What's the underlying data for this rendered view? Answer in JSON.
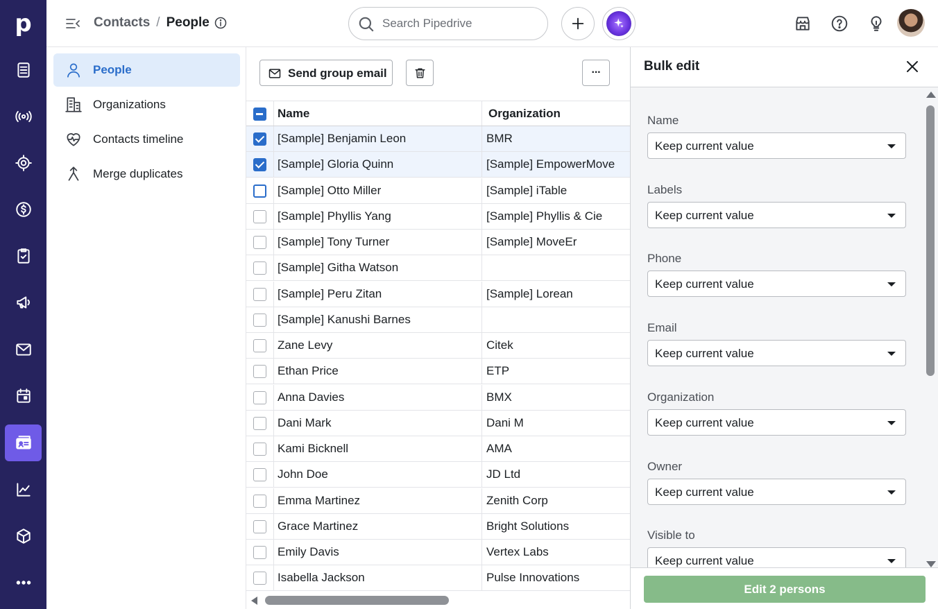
{
  "app": {
    "logo": "p"
  },
  "header": {
    "breadcrumb_parent": "Contacts",
    "breadcrumb_separator": "/",
    "breadcrumb_current": "People",
    "search_placeholder": "Search Pipedrive"
  },
  "rail": {
    "items": [
      {
        "icon": "leads-icon"
      },
      {
        "icon": "campaigns-broadcast-icon"
      },
      {
        "icon": "target-icon"
      },
      {
        "icon": "deals-dollar-icon"
      },
      {
        "icon": "activities-clipboard-icon"
      },
      {
        "icon": "megaphone-icon"
      },
      {
        "icon": "mail-icon"
      },
      {
        "icon": "calendar-icon"
      },
      {
        "icon": "contacts-card-icon",
        "active": true
      },
      {
        "icon": "insights-chart-icon"
      },
      {
        "icon": "products-box-icon"
      },
      {
        "icon": "more-dots-icon"
      }
    ]
  },
  "subnav": {
    "items": [
      {
        "label": "People",
        "icon": "person-icon",
        "active": true
      },
      {
        "label": "Organizations",
        "icon": "building-icon"
      },
      {
        "label": "Contacts timeline",
        "icon": "heart-pulse-icon"
      },
      {
        "label": "Merge duplicates",
        "icon": "merge-icon"
      }
    ]
  },
  "toolbar": {
    "send_group_email": "Send group email",
    "more": "···"
  },
  "table": {
    "columns": [
      "Name",
      "Organization"
    ],
    "rows": [
      {
        "name": "[Sample] Benjamin Leon",
        "org": "BMR",
        "checked": true
      },
      {
        "name": "[Sample] Gloria Quinn",
        "org": "[Sample] EmpowerMove",
        "checked": true
      },
      {
        "name": "[Sample] Otto Miller",
        "org": "[Sample] iTable",
        "checked": false
      },
      {
        "name": "[Sample] Phyllis Yang",
        "org": "[Sample] Phyllis & Cie",
        "checked": false
      },
      {
        "name": "[Sample] Tony Turner",
        "org": "[Sample] MoveEr",
        "checked": false
      },
      {
        "name": "[Sample] Githa Watson",
        "org": "",
        "checked": false
      },
      {
        "name": "[Sample] Peru Zitan",
        "org": "[Sample] Lorean",
        "checked": false
      },
      {
        "name": "[Sample] Kanushi Barnes",
        "org": "",
        "checked": false
      },
      {
        "name": "Zane Levy",
        "org": "Citek",
        "checked": false
      },
      {
        "name": "Ethan Price",
        "org": "ETP",
        "checked": false
      },
      {
        "name": "Anna Davies",
        "org": "BMX",
        "checked": false
      },
      {
        "name": "Dani Mark",
        "org": "Dani M",
        "checked": false
      },
      {
        "name": "Kami Bicknell",
        "org": "AMA",
        "checked": false
      },
      {
        "name": "John Doe",
        "org": "JD Ltd",
        "checked": false
      },
      {
        "name": "Emma Martinez",
        "org": "Zenith Corp",
        "checked": false
      },
      {
        "name": "Grace Martinez",
        "org": "Bright Solutions",
        "checked": false
      },
      {
        "name": "Emily Davis",
        "org": "Vertex Labs",
        "checked": false
      },
      {
        "name": "Isabella Jackson",
        "org": "Pulse Innovations",
        "checked": false
      }
    ]
  },
  "bulk_edit": {
    "title": "Bulk edit",
    "fields": [
      {
        "label": "Name",
        "value": "Keep current value"
      },
      {
        "label": "Labels",
        "value": "Keep current value"
      },
      {
        "label": "Phone",
        "value": "Keep current value"
      },
      {
        "label": "Email",
        "value": "Keep current value"
      },
      {
        "label": "Organization",
        "value": "Keep current value"
      },
      {
        "label": "Owner",
        "value": "Keep current value"
      },
      {
        "label": "Visible to",
        "value": "Keep current value"
      }
    ],
    "submit_label": "Edit 2 persons"
  },
  "colors": {
    "rail_bg": "#26235e",
    "rail_active": "#6f5be7",
    "accent_blue": "#2a6dca",
    "submit_green": "#86bb89"
  }
}
